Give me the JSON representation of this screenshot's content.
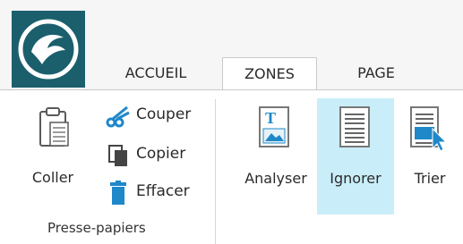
{
  "tabs": [
    {
      "label": "ACCUEIL",
      "active": false
    },
    {
      "label": "ZONES",
      "active": true
    },
    {
      "label": "PAGE",
      "active": false
    }
  ],
  "clipboard_group": {
    "paste_label": "Coller",
    "cut_label": "Couper",
    "copy_label": "Copier",
    "clear_label": "Effacer",
    "group_label": "Presse-papiers"
  },
  "zones_group": {
    "analyze_label": "Analyser",
    "ignore_label": "Ignorer",
    "sort_label": "Trier"
  },
  "icons": {
    "app_logo": "bird-logo-icon",
    "paste": "clipboard-icon",
    "cut": "scissors-icon",
    "copy": "copy-document-icon",
    "clear": "trash-icon",
    "analyze": "analyze-document-icon",
    "ignore": "document-ignore-icon",
    "sort": "sort-document-icon"
  },
  "colors": {
    "logo_bg": "#1b5f6d",
    "accent_blue": "#1e88c9",
    "highlight": "#c9eefa"
  }
}
